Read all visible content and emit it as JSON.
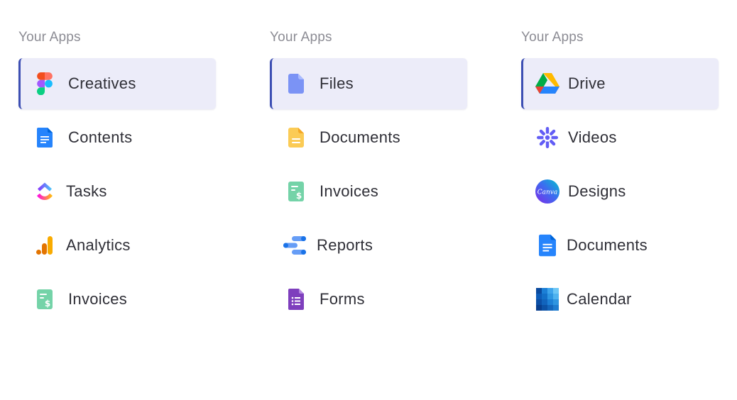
{
  "columns": [
    {
      "title": "Your Apps",
      "items": [
        {
          "label": "Creatives",
          "icon": "figma-icon",
          "active": true
        },
        {
          "label": "Contents",
          "icon": "google-docs-icon",
          "active": false
        },
        {
          "label": "Tasks",
          "icon": "clickup-icon",
          "active": false
        },
        {
          "label": "Analytics",
          "icon": "google-analytics-icon",
          "active": false
        },
        {
          "label": "Invoices",
          "icon": "invoice-icon",
          "active": false
        }
      ]
    },
    {
      "title": "Your Apps",
      "items": [
        {
          "label": "Files",
          "icon": "file-icon",
          "active": true
        },
        {
          "label": "Documents",
          "icon": "google-keep-doc-icon",
          "active": false
        },
        {
          "label": "Invoices",
          "icon": "invoice-icon",
          "active": false
        },
        {
          "label": "Reports",
          "icon": "data-studio-icon",
          "active": false
        },
        {
          "label": "Forms",
          "icon": "google-forms-icon",
          "active": false
        }
      ]
    },
    {
      "title": "Your Apps",
      "items": [
        {
          "label": "Drive",
          "icon": "google-drive-icon",
          "active": true
        },
        {
          "label": "Videos",
          "icon": "loom-icon",
          "active": false
        },
        {
          "label": "Designs",
          "icon": "canva-icon",
          "active": false
        },
        {
          "label": "Documents",
          "icon": "google-docs-icon",
          "active": false
        },
        {
          "label": "Calendar",
          "icon": "calendar-grid-icon",
          "active": false
        }
      ]
    }
  ],
  "icon_text": {
    "canva": "Canva"
  },
  "colors": {
    "active_background": "#ececf9",
    "active_border": "#3d4fb3",
    "heading": "#8c8c94",
    "label": "#2f2f37"
  }
}
